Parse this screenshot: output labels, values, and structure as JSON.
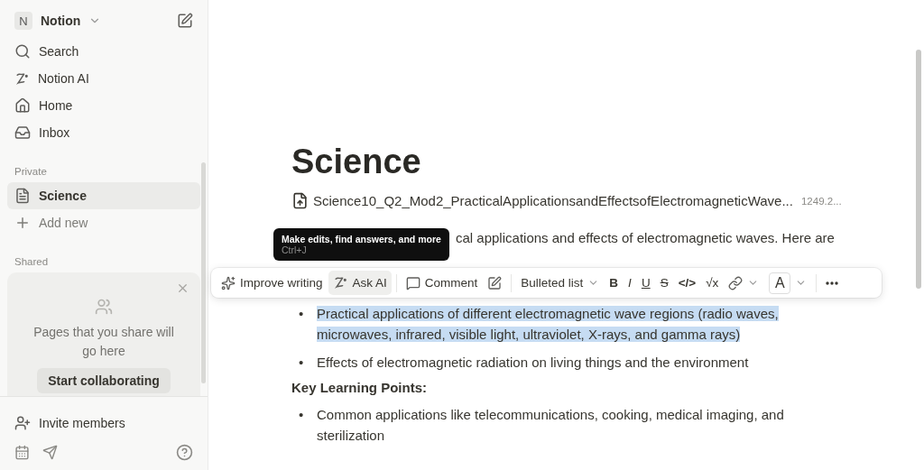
{
  "workspace": {
    "initial": "N",
    "name": "Notion"
  },
  "nav": [
    {
      "label": "Search",
      "kind": "search"
    },
    {
      "label": "Notion AI",
      "kind": "ai"
    },
    {
      "label": "Home",
      "kind": "home"
    },
    {
      "label": "Inbox",
      "kind": "inbox"
    }
  ],
  "private": {
    "label": "Private",
    "pages": [
      {
        "label": "Science",
        "selected": true
      }
    ],
    "add_new": "Add new"
  },
  "shared": {
    "label": "Shared",
    "card": {
      "text": "Pages that you share will go here",
      "button": "Start collaborating"
    }
  },
  "footer": {
    "invite": "Invite members"
  },
  "page": {
    "title": "Science",
    "file": {
      "name": "Science10_Q2_Mod2_PracticalApplicationsandEffectsofElectromagneticWave...",
      "size": "1249.2..."
    },
    "intro": "cal applications and effects of electromagnetic waves. Here are",
    "bullets": [
      {
        "marker": "•",
        "text": "Practical applications of different electromagnetic wave regions (radio waves, microwaves, infrared, visible light, ultraviolet, X-rays, and gamma rays)",
        "selected": true
      },
      {
        "marker": "•",
        "text": "Effects of electromagnetic radiation on living things and the environment",
        "selected": false
      }
    ],
    "heading": "Key Learning Points:",
    "bullets2": [
      {
        "marker": "•",
        "text": "Common applications like telecommunications, cooking, medical imaging, and sterilization",
        "selected": false
      }
    ]
  },
  "tooltip": {
    "title": "Make edits, find answers, and more",
    "shortcut": "Ctrl+J"
  },
  "toolbar": {
    "items": [
      {
        "kind": "improve",
        "label": "Improve writing",
        "active": false
      },
      {
        "kind": "ask",
        "label": "Ask AI",
        "active": true
      },
      {
        "kind": "sep"
      },
      {
        "kind": "comment",
        "label": "Comment",
        "active": false
      },
      {
        "kind": "edit",
        "active": false
      },
      {
        "kind": "sep"
      },
      {
        "kind": "block",
        "label": "Bulleted list",
        "active": false
      },
      {
        "kind": "bold",
        "label": "B",
        "active": false
      },
      {
        "kind": "italic",
        "label": "I",
        "active": false
      },
      {
        "kind": "underline",
        "label": "U",
        "active": false
      },
      {
        "kind": "strike",
        "label": "S",
        "active": false
      },
      {
        "kind": "code",
        "label": "</>",
        "active": false
      },
      {
        "kind": "math",
        "label": "√x",
        "active": false
      },
      {
        "kind": "link",
        "active": false
      },
      {
        "kind": "color",
        "label": "A",
        "active": false
      },
      {
        "kind": "sep"
      },
      {
        "kind": "more",
        "active": false
      }
    ]
  }
}
